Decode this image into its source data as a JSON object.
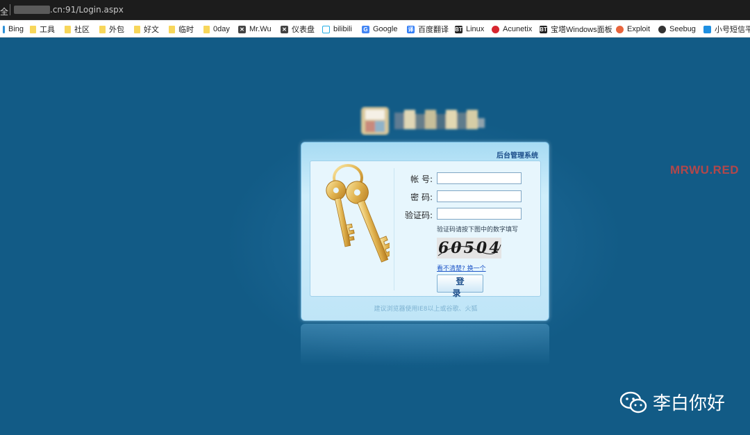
{
  "browser": {
    "secure_label": "全",
    "url": ".cn:91/Login.aspx",
    "bookmarks": [
      {
        "label": "Bing",
        "icon": "bing-icon"
      },
      {
        "label": "工具",
        "icon": "folder-icon"
      },
      {
        "label": "社区",
        "icon": "folder-icon"
      },
      {
        "label": "外包",
        "icon": "folder-icon"
      },
      {
        "label": "好文",
        "icon": "folder-icon"
      },
      {
        "label": "临时",
        "icon": "folder-icon"
      },
      {
        "label": "0day",
        "icon": "folder-icon"
      },
      {
        "label": "Mr.Wu",
        "icon": "user-icon"
      },
      {
        "label": "仪表盘",
        "icon": "user-icon"
      },
      {
        "label": "bilibili",
        "icon": "bilibili-icon"
      },
      {
        "label": "Google",
        "icon": "google-translate-icon"
      },
      {
        "label": "百度翻译",
        "icon": "baidu-translate-icon"
      },
      {
        "label": "Linux",
        "icon": "bt-icon"
      },
      {
        "label": "Acunetix",
        "icon": "acunetix-icon"
      },
      {
        "label": "宝塔Windows面板",
        "icon": "bt-icon"
      },
      {
        "label": "Exploit",
        "icon": "exploit-icon"
      },
      {
        "label": "Seebug",
        "icon": "seebug-icon"
      },
      {
        "label": "小号短信平台",
        "icon": "sms-icon"
      }
    ]
  },
  "login": {
    "title": "后台管理系统",
    "username_label": "帐 号:",
    "password_label": "密 码:",
    "captcha_label": "验证码:",
    "username_value": "",
    "password_value": "",
    "captcha_value": "",
    "captcha_hint": "验证码请按下图中的数字填写",
    "captcha_text": "60504",
    "refresh_link": "看不清楚? 换一个",
    "submit_label": "登 录",
    "footer_note": "建议浏览器使用IE8以上或谷歌、火狐"
  },
  "watermarks": {
    "site": "MRWU.RED",
    "wechat": "李白你好"
  },
  "colors": {
    "page_bg": "#125b86",
    "panel_title": "#1b4d8a",
    "link": "#1e56c8",
    "watermark_red": "#b3474a"
  }
}
